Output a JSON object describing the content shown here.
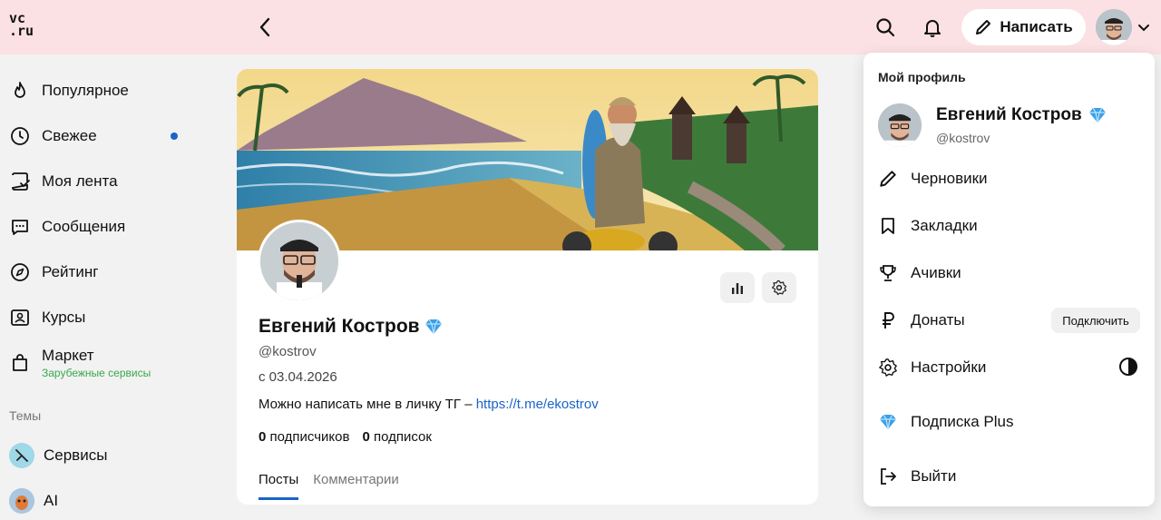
{
  "header": {
    "logo_line1": "vc",
    "logo_line2": ".ru",
    "write_label": "Написать",
    "icons": {
      "back": "chevron-left-icon",
      "search": "search-icon",
      "notifications": "bell-icon",
      "write": "pencil-icon",
      "menu": "chevron-down-icon"
    }
  },
  "sidebar": {
    "items": [
      {
        "label": "Популярное",
        "icon": "flame-icon"
      },
      {
        "label": "Свежее",
        "icon": "clock-icon",
        "has_dot": true
      },
      {
        "label": "Моя лента",
        "icon": "feed-icon"
      },
      {
        "label": "Сообщения",
        "icon": "chat-icon"
      },
      {
        "label": "Рейтинг",
        "icon": "compass-icon"
      },
      {
        "label": "Курсы",
        "icon": "courses-icon"
      },
      {
        "label": "Маркет",
        "icon": "bag-icon",
        "sub": "Зарубежные сервисы"
      }
    ],
    "themes_title": "Темы",
    "themes": [
      {
        "label": "Сервисы",
        "icon": "services-theme-icon"
      },
      {
        "label": "AI",
        "icon": "ai-theme-icon"
      }
    ]
  },
  "profile": {
    "name": "Евгений Костров",
    "handle": "@kostrov",
    "since": "с 03.04.2026",
    "bio_text": "Можно написать мне в личку ТГ – ",
    "bio_link": "https://t.me/ekostrov",
    "subscribers_count": "0",
    "subscribers_label": "подписчиков",
    "subscriptions_count": "0",
    "subscriptions_label": "подписок",
    "tabs": [
      "Посты",
      "Комментарии"
    ],
    "active_tab": 0
  },
  "dropdown": {
    "title": "Мой профиль",
    "name": "Евгений Костров",
    "handle": "@kostrov",
    "items": [
      {
        "label": "Черновики",
        "icon": "pencil-icon"
      },
      {
        "label": "Закладки",
        "icon": "bookmark-icon"
      },
      {
        "label": "Ачивки",
        "icon": "trophy-icon"
      },
      {
        "label": "Донаты",
        "icon": "ruble-icon",
        "action": "Подключить"
      },
      {
        "label": "Настройки",
        "icon": "gear-icon"
      },
      {
        "label": "Подписка Plus",
        "icon": "diamond-icon"
      },
      {
        "label": "Выйти",
        "icon": "logout-icon"
      }
    ]
  },
  "colors": {
    "header_bg": "#fbe1e3",
    "accent": "#1a64c8",
    "market_sub": "#38a84b",
    "diamond": "#3aa0e8"
  }
}
